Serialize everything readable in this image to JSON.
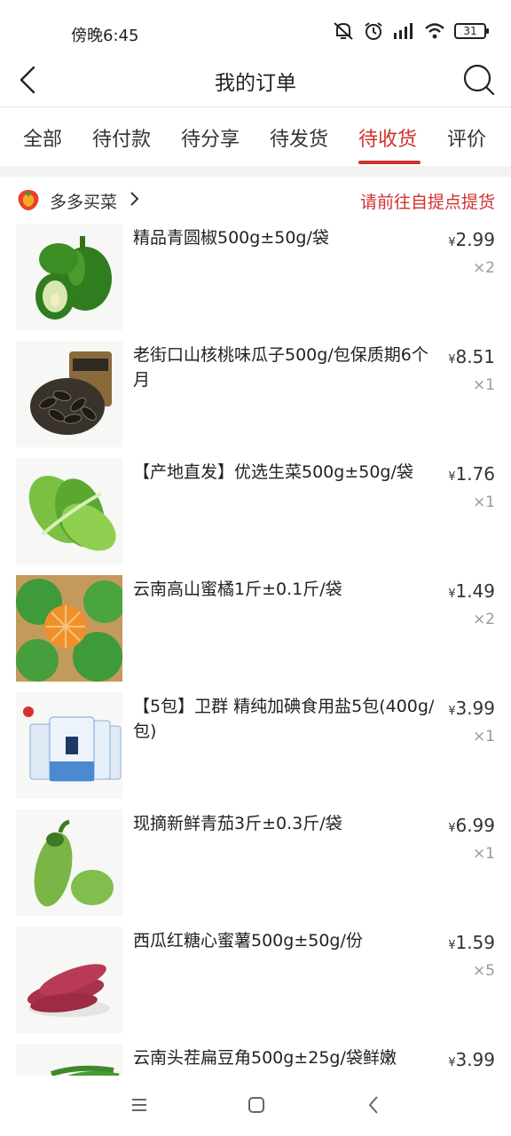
{
  "status_bar": {
    "time": "傍晚6:45",
    "battery": "31"
  },
  "header": {
    "title": "我的订单"
  },
  "tabs": [
    {
      "label": "全部"
    },
    {
      "label": "待付款"
    },
    {
      "label": "待分享"
    },
    {
      "label": "待发货"
    },
    {
      "label": "待收货"
    },
    {
      "label": "评价"
    }
  ],
  "active_tab": "待收货",
  "store": {
    "name": "多多买菜",
    "pickup_note": "请前往自提点提货"
  },
  "currency_symbol": "¥",
  "items": [
    {
      "title": "精品青圆椒500g±50g/袋",
      "price": "2.99",
      "qty": "×2",
      "image": "green-bell-pepper"
    },
    {
      "title": "老街口山核桃味瓜子500g/包保质期6个月",
      "price": "8.51",
      "qty": "×1",
      "image": "sunflower-seeds"
    },
    {
      "title": "【产地直发】优选生菜500g±50g/袋",
      "price": "1.76",
      "qty": "×1",
      "image": "romaine-lettuce"
    },
    {
      "title": "云南高山蜜橘1斤±0.1斤/袋",
      "price": "1.49",
      "qty": "×2",
      "image": "mandarin-oranges"
    },
    {
      "title": "【5包】卫群 精纯加碘食用盐5包(400g/包)",
      "price": "3.99",
      "qty": "×1",
      "image": "salt-packs"
    },
    {
      "title": "现摘新鲜青茄3斤±0.3斤/袋",
      "price": "6.99",
      "qty": "×1",
      "image": "green-eggplant"
    },
    {
      "title": "西瓜红糖心蜜薯500g±50g/份",
      "price": "1.59",
      "qty": "×5",
      "image": "sweet-potatoes"
    },
    {
      "title": "云南头茬扁豆角500g±25g/袋鲜嫩",
      "price": "3.99",
      "qty": "",
      "image": "flat-beans"
    }
  ],
  "colors": {
    "accent": "#d0302f",
    "text": "#222222",
    "muted": "#999999"
  }
}
